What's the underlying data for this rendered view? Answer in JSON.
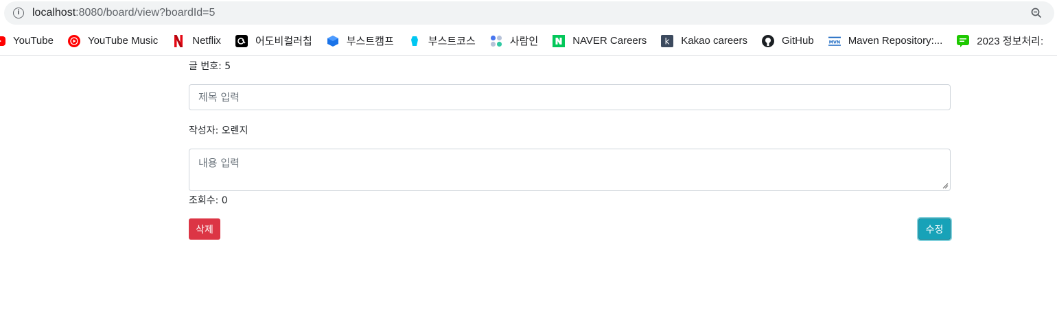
{
  "browser": {
    "url_host": "localhost",
    "url_rest": ":8080/board/view?boardId=5",
    "bookmarks": [
      {
        "label": "YouTube",
        "icon": "youtube-icon"
      },
      {
        "label": "YouTube Music",
        "icon": "youtube-music-icon"
      },
      {
        "label": "Netflix",
        "icon": "netflix-icon"
      },
      {
        "label": "어도비컬러칩",
        "icon": "adobe-color-icon"
      },
      {
        "label": "부스트캠프",
        "icon": "boostcamp-icon"
      },
      {
        "label": "부스트코스",
        "icon": "boostcourse-icon"
      },
      {
        "label": "사람인",
        "icon": "saramin-icon"
      },
      {
        "label": "NAVER Careers",
        "icon": "naver-icon"
      },
      {
        "label": "Kakao careers",
        "icon": "kakao-icon"
      },
      {
        "label": "GitHub",
        "icon": "github-icon"
      },
      {
        "label": "Maven Repository:...",
        "icon": "maven-icon"
      },
      {
        "label": "2023 정보처리:",
        "icon": "chat-icon"
      }
    ]
  },
  "board": {
    "board_id_text": "글 번호: 5",
    "title_placeholder": "제목 입력",
    "author_text": "작성자: 오렌지",
    "content_placeholder": "내용 입력",
    "views_text": "조회수: 0",
    "delete_label": "삭제",
    "edit_label": "수정"
  },
  "colors": {
    "delete": "#dc3545",
    "edit": "#17a2b8",
    "edit_border": "#138496"
  }
}
